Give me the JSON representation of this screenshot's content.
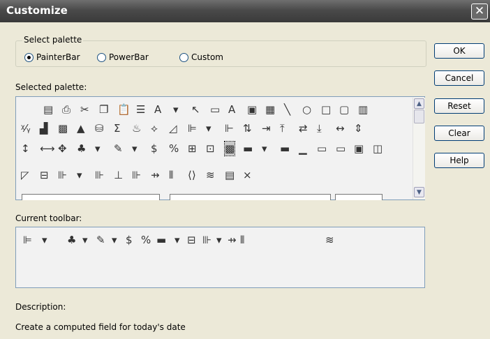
{
  "window": {
    "title": "Customize",
    "close_glyph": "✕"
  },
  "select_palette": {
    "legend": "Select palette",
    "options": [
      {
        "label": "PainterBar",
        "selected": true
      },
      {
        "label": "PowerBar",
        "selected": false
      },
      {
        "label": "Custom",
        "selected": false
      }
    ]
  },
  "selected_palette": {
    "label": "Selected palette:",
    "rows": [
      [
        {
          "name": "save-icon",
          "glyph": "▤"
        },
        {
          "name": "print-icon",
          "glyph": "⎙"
        },
        {
          "name": "cut-icon",
          "glyph": "✂"
        },
        {
          "name": "copy-icon",
          "glyph": "❐"
        },
        {
          "name": "paste-icon",
          "glyph": "📋"
        },
        {
          "name": "list-icon",
          "glyph": "☰"
        },
        {
          "name": "text-a-icon",
          "glyph": "A"
        },
        {
          "name": "dropdown-arrow-icon",
          "glyph": "▾"
        },
        {
          "name": "pointer-icon",
          "glyph": "↖"
        },
        {
          "name": "picture-icon",
          "glyph": "▭"
        },
        {
          "name": "text-a-icon",
          "glyph": "A"
        },
        {
          "name": "image-icon",
          "glyph": "▣"
        },
        {
          "name": "grid-icon",
          "glyph": "▦"
        },
        {
          "name": "line-icon",
          "glyph": "╲"
        },
        {
          "name": "oval-icon",
          "glyph": "○"
        },
        {
          "name": "rectangle-icon",
          "glyph": "□"
        },
        {
          "name": "round-rect-icon",
          "glyph": "▢"
        },
        {
          "name": "bars-icon",
          "glyph": "▥"
        }
      ],
      [
        {
          "name": "xy-sort-icon",
          "glyph": "ᵡ⁄ᵧ"
        },
        {
          "name": "graph-icon",
          "glyph": "▟"
        },
        {
          "name": "report-icon",
          "glyph": "▩"
        },
        {
          "name": "triangle-icon",
          "glyph": "▲"
        },
        {
          "name": "database-icon",
          "glyph": "⛁"
        },
        {
          "name": "sum-icon",
          "glyph": "Σ"
        },
        {
          "name": "fire-icon",
          "glyph": "♨"
        },
        {
          "name": "tag-icon",
          "glyph": "⟡"
        },
        {
          "name": "edit-icon",
          "glyph": "◿"
        },
        {
          "name": "align-left-icon",
          "glyph": "⊫"
        },
        {
          "name": "dropdown-arrow-icon",
          "glyph": "▾"
        },
        {
          "name": "align-right-icon",
          "glyph": "⊩"
        },
        {
          "name": "space-vertical-icon",
          "glyph": "⇅"
        },
        {
          "name": "align-center-icon",
          "glyph": "⇥"
        },
        {
          "name": "align-top-icon",
          "glyph": "⤒"
        },
        {
          "name": "space-horizontal-icon",
          "glyph": "⇄"
        },
        {
          "name": "align-bottom-icon",
          "glyph": "⤓"
        },
        {
          "name": "width-icon",
          "glyph": "↔"
        },
        {
          "name": "height-icon",
          "glyph": "⇕"
        }
      ],
      [
        {
          "name": "resize-height-icon",
          "glyph": "↕"
        },
        {
          "name": "resize-width-icon",
          "glyph": "⟷"
        },
        {
          "name": "resize-both-icon",
          "glyph": "✥"
        },
        {
          "name": "background-color-icon",
          "glyph": "♣"
        },
        {
          "name": "dropdown-arrow-icon",
          "glyph": "▾"
        },
        {
          "name": "paint-brush-icon",
          "glyph": "✎"
        },
        {
          "name": "dropdown-arrow-icon",
          "glyph": "▾"
        },
        {
          "name": "currency-icon",
          "glyph": "$"
        },
        {
          "name": "percent-icon",
          "glyph": "%"
        },
        {
          "name": "computed-icon",
          "glyph": "⊞"
        },
        {
          "name": "properties-icon",
          "glyph": "⊡"
        },
        {
          "name": "today-icon",
          "glyph": "▩",
          "selected": true
        },
        {
          "name": "border-none-icon",
          "glyph": "▬"
        },
        {
          "name": "dropdown-arrow-icon",
          "glyph": "▾"
        },
        {
          "name": "border-none-icon",
          "glyph": "▬"
        },
        {
          "name": "border-underline-icon",
          "glyph": "▁"
        },
        {
          "name": "border-box-icon",
          "glyph": "▭"
        },
        {
          "name": "border-shadow-icon",
          "glyph": "▭"
        },
        {
          "name": "border-raised-icon",
          "glyph": "▣"
        },
        {
          "name": "border-lowered-icon",
          "glyph": "◫"
        }
      ],
      [
        {
          "name": "border-resize-icon",
          "glyph": "◸"
        },
        {
          "name": "tab-order-icon",
          "glyph": "⊟"
        },
        {
          "name": "align-icon",
          "glyph": "⊪"
        },
        {
          "name": "dropdown-arrow-icon",
          "glyph": "▾"
        },
        {
          "name": "size-icon",
          "glyph": "⊪"
        },
        {
          "name": "space-icon",
          "glyph": "⊥"
        },
        {
          "name": "pad-icon",
          "glyph": "⊪"
        },
        {
          "name": "slide-icon",
          "glyph": "⇸"
        },
        {
          "name": "columns-icon",
          "glyph": "⫴"
        },
        {
          "name": "code-icon",
          "glyph": "⟨⟩"
        },
        {
          "name": "group-icon",
          "glyph": "≋"
        },
        {
          "name": "page-icon",
          "glyph": "▤"
        },
        {
          "name": "delete-icon",
          "glyph": "×"
        }
      ]
    ]
  },
  "current_toolbar": {
    "label": "Current toolbar:",
    "items": [
      {
        "name": "align-left-icon",
        "glyph": "⊫"
      },
      {
        "name": "dropdown-arrow-icon",
        "glyph": "▾"
      },
      {
        "name": "background-color-icon",
        "glyph": "♣"
      },
      {
        "name": "dropdown-arrow-icon",
        "glyph": "▾"
      },
      {
        "name": "paint-brush-icon",
        "glyph": "✎"
      },
      {
        "name": "dropdown-arrow-icon",
        "glyph": "▾"
      },
      {
        "name": "currency-icon",
        "glyph": "$"
      },
      {
        "name": "percent-icon",
        "glyph": "%"
      },
      {
        "name": "border-none-icon",
        "glyph": "▬"
      },
      {
        "name": "dropdown-arrow-icon",
        "glyph": "▾"
      },
      {
        "name": "tab-order-icon",
        "glyph": "⊟"
      },
      {
        "name": "align-icon",
        "glyph": "⊪"
      },
      {
        "name": "dropdown-arrow-icon",
        "glyph": "▾"
      },
      {
        "name": "slide-icon",
        "glyph": "⇸"
      },
      {
        "name": "columns-icon",
        "glyph": "⫴"
      },
      {
        "name": "group-icon",
        "glyph": "≋"
      }
    ]
  },
  "description": {
    "label": "Description:",
    "text": "Create a computed field for today's date"
  },
  "buttons": {
    "ok": "OK",
    "cancel": "Cancel",
    "reset": "Reset",
    "clear": "Clear",
    "help": "Help"
  },
  "scrollbar": {
    "up": "▲",
    "down": "▼"
  }
}
